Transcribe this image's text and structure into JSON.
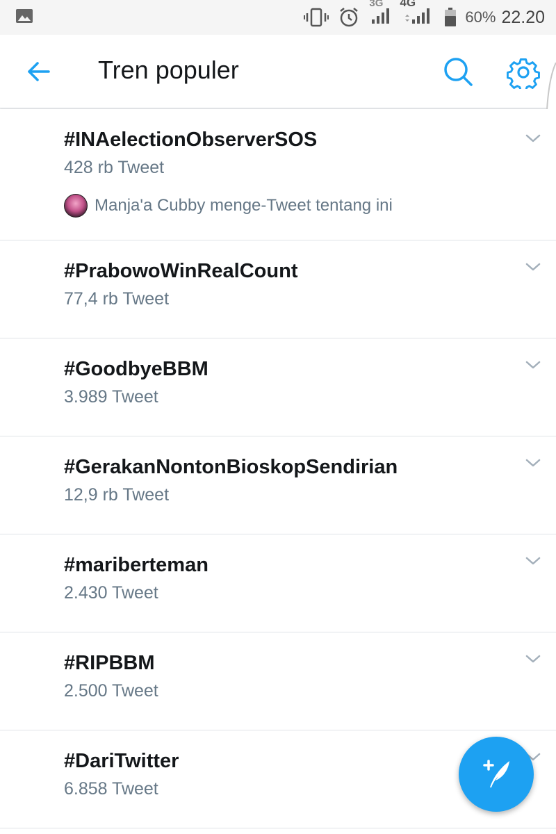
{
  "status_bar": {
    "network_3g": "3G",
    "network_4g": "4G",
    "battery_percent": "60%",
    "time": "22.20",
    "icons": [
      "image-icon",
      "vibrate-icon",
      "alarm-icon",
      "signal-icon",
      "signal-4g-icon",
      "battery-icon"
    ]
  },
  "header": {
    "title": "Tren populer",
    "icons": [
      "back-arrow-icon",
      "search-icon",
      "settings-icon"
    ],
    "accent_color": "#1da1f2"
  },
  "trends": [
    {
      "name": "#INAelectionObserverSOS",
      "count": "428 rb Tweet",
      "context": "Manja'a Cubby menge-Tweet tentang ini"
    },
    {
      "name": "#PrabowoWinRealCount",
      "count": "77,4 rb Tweet"
    },
    {
      "name": "#GoodbyeBBM",
      "count": "3.989 Tweet"
    },
    {
      "name": "#GerakanNontonBioskopSendirian",
      "count": "12,9 rb Tweet"
    },
    {
      "name": "#mariberteman",
      "count": "2.430 Tweet"
    },
    {
      "name": "#RIPBBM",
      "count": "2.500 Tweet"
    },
    {
      "name": "#DariTwitter",
      "count": "6.858 Tweet"
    }
  ],
  "fab": {
    "icon": "compose-tweet-icon",
    "color": "#1da1f2"
  }
}
